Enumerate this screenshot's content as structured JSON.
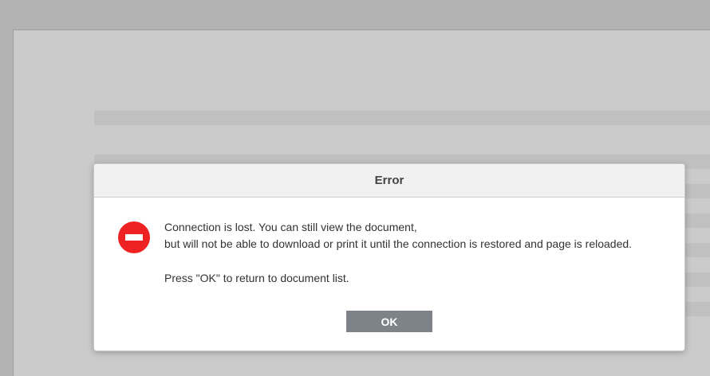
{
  "dialog": {
    "title": "Error",
    "message_line1": "Connection is lost. You can still view the document,",
    "message_line2": "but will not be able to download or print it until the connection is restored and page is reloaded.",
    "message_line3": "Press \"OK\" to return to document list.",
    "ok_label": "OK",
    "icon": "error-stop-icon",
    "icon_color": "#ee2222",
    "button_color": "#7e8389"
  }
}
